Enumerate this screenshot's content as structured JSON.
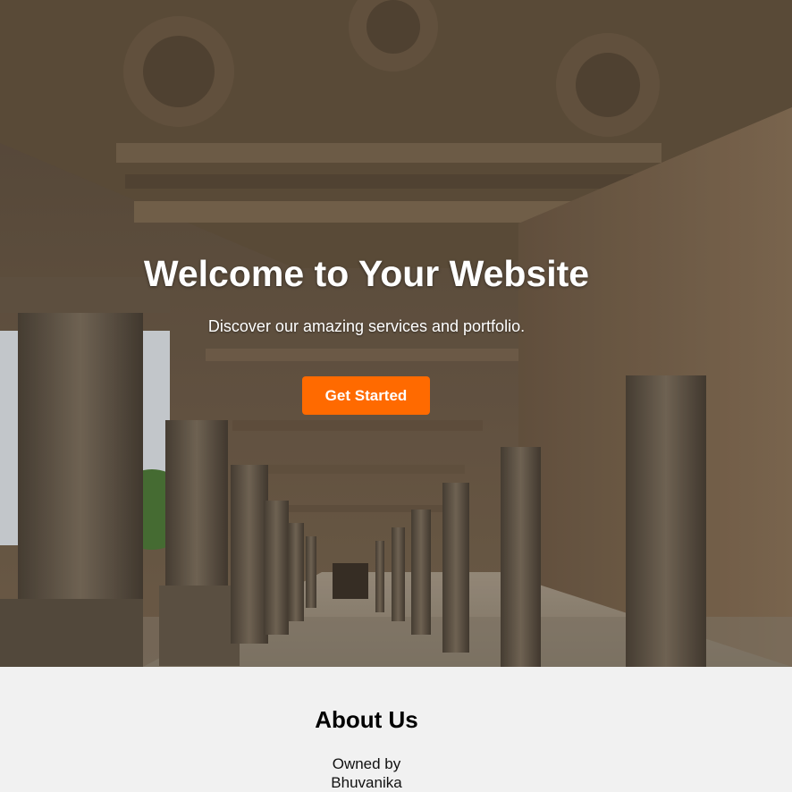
{
  "hero": {
    "title": "Welcome to Your Website",
    "subtitle": "Discover our amazing services and portfolio.",
    "cta_label": "Get Started",
    "background_image": "stone-temple-colonnade",
    "cta_color": "#ff6a00"
  },
  "about": {
    "title": "About Us",
    "owner_line1": "Owned by",
    "owner_line2": "Bhuvanika",
    "background_color": "#f1f1f1"
  }
}
